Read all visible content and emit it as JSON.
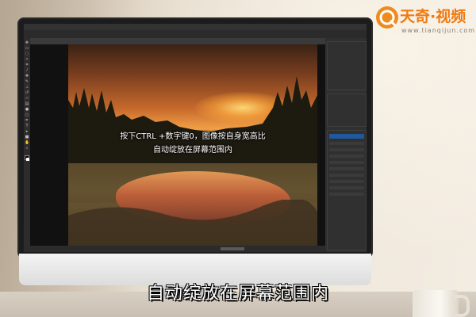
{
  "watermark": {
    "brand": "天奇·视频",
    "url": "www.tianqijun.com",
    "accent_color": "#f07a10"
  },
  "subtitle": "自动绽放在屏幕范围内",
  "photo_caption": {
    "line1": "按下CTRL +数字键0，图像按自身宽高比",
    "line2": "自动绽放在屏幕范围内"
  },
  "photoshop": {
    "accent_color": "#1473e6",
    "icons": [
      "move-icon",
      "marquee-icon",
      "lasso-icon",
      "magic-wand-icon",
      "crop-icon",
      "eyedropper-icon",
      "healing-brush-icon",
      "brush-icon",
      "clone-stamp-icon",
      "history-brush-icon",
      "eraser-icon",
      "gradient-icon",
      "blur-icon",
      "dodge-icon",
      "pen-icon",
      "type-icon",
      "path-selection-icon",
      "shape-icon",
      "hand-icon",
      "zoom-icon"
    ]
  }
}
